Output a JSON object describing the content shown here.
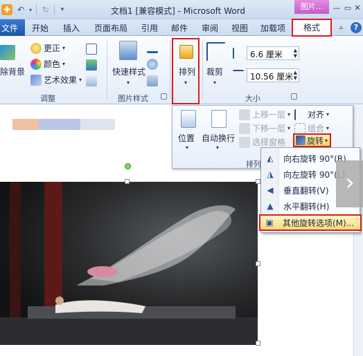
{
  "titlebar": {
    "title": "文档1 [兼容模式] - Microsoft Word",
    "context_group": "图片..."
  },
  "tabs": {
    "file": "文件",
    "items": [
      "开始",
      "插入",
      "页面布局",
      "引用",
      "邮件",
      "审阅",
      "视图",
      "加载项"
    ],
    "format": "格式"
  },
  "ribbon": {
    "adjust": {
      "remove_bg": "除背景",
      "corrections": "更正",
      "color": "颜色",
      "artistic": "艺术效果",
      "label": "调整"
    },
    "picture_styles": {
      "quick_styles": "快速样式",
      "label": "图片样式"
    },
    "arrange": {
      "label": "排列"
    },
    "size": {
      "crop": "裁剪",
      "height": "6.6 厘米",
      "width": "10.56 厘米",
      "label": "大小"
    }
  },
  "arrange_panel": {
    "position": "位置",
    "wrap_text": "自动换行",
    "bring_forward": "上移一层",
    "send_backward": "下移一层",
    "selection_pane": "选择窗格",
    "align": "对齐",
    "group": "组合",
    "rotate": "旋转",
    "label": "排列"
  },
  "rotate_menu": {
    "items": [
      "向右旋转 90°(R)",
      "向左旋转 90°(L)",
      "垂直翻转(V)",
      "水平翻转(H)",
      "其他旋转选项(M)..."
    ]
  },
  "colors": {
    "accent_red": "#e0191b",
    "ribbon_blue": "#2f6fc4"
  }
}
